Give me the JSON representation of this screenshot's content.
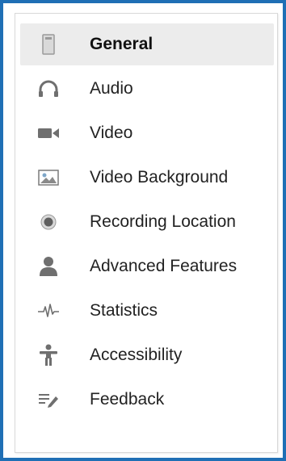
{
  "settings_nav": {
    "items": [
      {
        "label": "General",
        "icon": "general-icon",
        "selected": true
      },
      {
        "label": "Audio",
        "icon": "headphones-icon",
        "selected": false
      },
      {
        "label": "Video",
        "icon": "video-camera-icon",
        "selected": false
      },
      {
        "label": "Video Background",
        "icon": "image-icon",
        "selected": false
      },
      {
        "label": "Recording Location",
        "icon": "record-icon",
        "selected": false
      },
      {
        "label": "Advanced Features",
        "icon": "person-icon",
        "selected": false
      },
      {
        "label": "Statistics",
        "icon": "pulse-icon",
        "selected": false
      },
      {
        "label": "Accessibility",
        "icon": "accessibility-icon",
        "selected": false
      },
      {
        "label": "Feedback",
        "icon": "feedback-icon",
        "selected": false
      }
    ]
  },
  "colors": {
    "frame_border": "#1f6fb5",
    "selected_background": "#ececec",
    "icon_gray": "#6f6f6f"
  }
}
